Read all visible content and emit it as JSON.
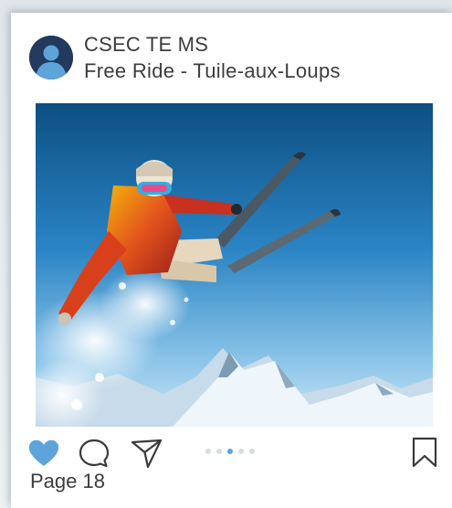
{
  "post": {
    "account_name": "CSEC TE MS",
    "location": "Free Ride - Tuile-aux-Loups",
    "avatar_icon": "user-avatar-icon",
    "photo_subject": "skier-jump-photo"
  },
  "actions": {
    "like_icon": "heart-icon",
    "comment_icon": "comment-bubble-icon",
    "share_icon": "paper-plane-icon",
    "save_icon": "bookmark-icon",
    "like_color": "#5ea3da"
  },
  "carousel": {
    "dot_count": 5,
    "active_index": 2,
    "active_color": "#5ea3da",
    "inactive_color": "#d7dce0"
  },
  "footer": {
    "page_label": "Page 18"
  }
}
